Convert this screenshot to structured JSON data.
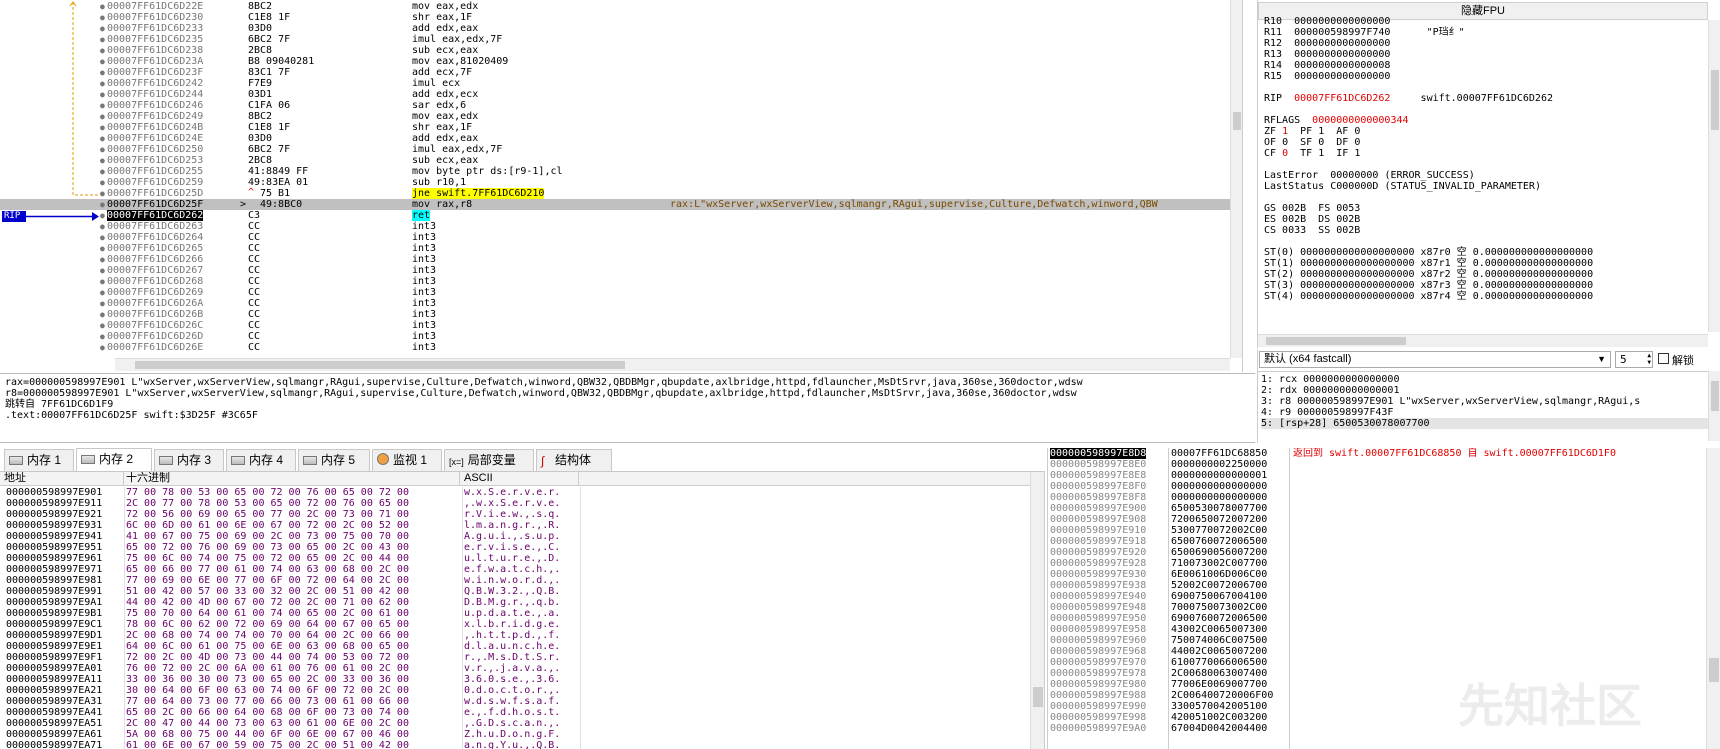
{
  "disasm": {
    "rows": [
      {
        "addr": "00007FF61DC6D22E",
        "bytes": "8BC2",
        "instr": "mov eax,edx",
        "comment": ""
      },
      {
        "addr": "00007FF61DC6D230",
        "bytes": "C1E8 1F",
        "instr": "shr eax,1F",
        "comment": ""
      },
      {
        "addr": "00007FF61DC6D233",
        "bytes": "03D0",
        "instr": "add edx,eax",
        "comment": ""
      },
      {
        "addr": "00007FF61DC6D235",
        "bytes": "6BC2 7F",
        "instr": "imul eax,edx,7F",
        "comment": ""
      },
      {
        "addr": "00007FF61DC6D238",
        "bytes": "2BC8",
        "instr": "sub ecx,eax",
        "comment": ""
      },
      {
        "addr": "00007FF61DC6D23A",
        "bytes": "B8 09040281",
        "instr": "mov eax,81020409",
        "comment": ""
      },
      {
        "addr": "00007FF61DC6D23F",
        "bytes": "83C1 7F",
        "instr": "add ecx,7F",
        "comment": ""
      },
      {
        "addr": "00007FF61DC6D242",
        "bytes": "F7E9",
        "instr": "imul ecx",
        "comment": ""
      },
      {
        "addr": "00007FF61DC6D244",
        "bytes": "03D1",
        "instr": "add edx,ecx",
        "comment": ""
      },
      {
        "addr": "00007FF61DC6D246",
        "bytes": "C1FA 06",
        "instr": "sar edx,6",
        "comment": ""
      },
      {
        "addr": "00007FF61DC6D249",
        "bytes": "8BC2",
        "instr": "mov eax,edx",
        "comment": ""
      },
      {
        "addr": "00007FF61DC6D24B",
        "bytes": "C1E8 1F",
        "instr": "shr eax,1F",
        "comment": ""
      },
      {
        "addr": "00007FF61DC6D24E",
        "bytes": "03D0",
        "instr": "add edx,eax",
        "comment": ""
      },
      {
        "addr": "00007FF61DC6D250",
        "bytes": "6BC2 7F",
        "instr": "imul eax,edx,7F",
        "comment": ""
      },
      {
        "addr": "00007FF61DC6D253",
        "bytes": "2BC8",
        "instr": "sub ecx,eax",
        "comment": ""
      },
      {
        "addr": "00007FF61DC6D255",
        "bytes": "41:8849 FF",
        "instr": "mov byte ptr ds:[r9-1],cl",
        "comment": ""
      },
      {
        "addr": "00007FF61DC6D259",
        "bytes": "49:83EA 01",
        "instr": "sub r10,1",
        "comment": ""
      },
      {
        "addr": "00007FF61DC6D25D",
        "bytes": "75 B1",
        "instr": "jne swift.7FF61DC6D210",
        "comment": ""
      },
      {
        "addr": "00007FF61DC6D25F",
        "bytes": "49:8BC0",
        "instr": "mov rax,r8",
        "comment": "rax:L\"wxServer,wxServerView,sqlmangr,RAgui,supervise,Culture,Defwatch,winword,QBW"
      },
      {
        "addr": "00007FF61DC6D262",
        "bytes": "C3",
        "instr": "ret",
        "comment": ""
      },
      {
        "addr": "00007FF61DC6D263",
        "bytes": "CC",
        "instr": "int3",
        "comment": ""
      },
      {
        "addr": "00007FF61DC6D264",
        "bytes": "CC",
        "instr": "int3",
        "comment": ""
      },
      {
        "addr": "00007FF61DC6D265",
        "bytes": "CC",
        "instr": "int3",
        "comment": ""
      },
      {
        "addr": "00007FF61DC6D266",
        "bytes": "CC",
        "instr": "int3",
        "comment": ""
      },
      {
        "addr": "00007FF61DC6D267",
        "bytes": "CC",
        "instr": "int3",
        "comment": ""
      },
      {
        "addr": "00007FF61DC6D268",
        "bytes": "CC",
        "instr": "int3",
        "comment": ""
      },
      {
        "addr": "00007FF61DC6D269",
        "bytes": "CC",
        "instr": "int3",
        "comment": ""
      },
      {
        "addr": "00007FF61DC6D26A",
        "bytes": "CC",
        "instr": "int3",
        "comment": ""
      },
      {
        "addr": "00007FF61DC6D26B",
        "bytes": "CC",
        "instr": "int3",
        "comment": ""
      },
      {
        "addr": "00007FF61DC6D26C",
        "bytes": "CC",
        "instr": "int3",
        "comment": ""
      },
      {
        "addr": "00007FF61DC6D26D",
        "bytes": "CC",
        "instr": "int3",
        "comment": ""
      },
      {
        "addr": "00007FF61DC6D26E",
        "bytes": "CC",
        "instr": "int3",
        "comment": ""
      }
    ],
    "rip_label": "RIP",
    "current_row": 19,
    "selected_row": 18,
    "jump_row": 17,
    "jump_mark": "^",
    "sel_mark": ">"
  },
  "info": {
    "lines": [
      "rax=000000598997E901 L\"wxServer,wxServerView,sqlmangr,RAgui,supervise,Culture,Defwatch,winword,QBW32,QBDBMgr,qbupdate,axlbridge,httpd,fdlauncher,MsDtSrvr,java,360se,360doctor,wdsw",
      "r8=000000598997E901 L\"wxServer,wxServerView,sqlmangr,RAgui,supervise,Culture,Defwatch,winword,QBW32,QBDBMgr,qbupdate,axlbridge,httpd,fdlauncher,MsDtSrvr,java,360se,360doctor,wdsw",
      "跳转自 7FF61DC6D1F9",
      "",
      ".text:00007FF61DC6D25F swift:$3D25F #3C65F"
    ]
  },
  "registers": {
    "header": "隐藏FPU",
    "lines": [
      {
        "t": "R10  ",
        "v": "0000000000000000",
        "r": "         ",
        "x": ""
      },
      {
        "t": "R11  ",
        "v": "000000598997F740",
        "r": "      ",
        "x": "\"P珰纟\""
      },
      {
        "t": "R12  ",
        "v": "0000000000000000",
        "r": "",
        "x": ""
      },
      {
        "t": "R13  ",
        "v": "0000000000000000",
        "r": "",
        "x": ""
      },
      {
        "t": "R14  ",
        "v": "0000000000000008",
        "r": "",
        "x": ""
      },
      {
        "t": "R15  ",
        "v": "0000000000000000",
        "r": "",
        "x": ""
      },
      {
        "t": "",
        "v": "",
        "r": "",
        "x": ""
      },
      {
        "t": "RIP  ",
        "v": "00007FF61DC6D262",
        "r": "     ",
        "x": "swift.00007FF61DC6D262",
        "red": true
      },
      {
        "t": "",
        "v": "",
        "r": "",
        "x": ""
      },
      {
        "t": "RFLAGS  ",
        "v": "0000000000000344",
        "r": "",
        "x": "",
        "red": true
      },
      {
        "t": "ZF ",
        "v": "1",
        "r": "  PF ",
        "x": "1  AF 0",
        "redv": true
      },
      {
        "t": "OF ",
        "v": "0",
        "r": "  SF ",
        "x": "0  DF 0"
      },
      {
        "t": "CF ",
        "v": "0",
        "r": "  TF ",
        "x": "1  IF 1",
        "redv2": true
      },
      {
        "t": "",
        "v": "",
        "r": "",
        "x": ""
      },
      {
        "t": "LastError  ",
        "v": "00000000",
        "r": " ",
        "x": "(ERROR_SUCCESS)"
      },
      {
        "t": "LastStatus ",
        "v": "C000000D",
        "r": " ",
        "x": "(STATUS_INVALID_PARAMETER)"
      },
      {
        "t": "",
        "v": "",
        "r": "",
        "x": ""
      },
      {
        "t": "GS 002B  FS 0053",
        "v": "",
        "r": "",
        "x": ""
      },
      {
        "t": "ES 002B  DS 002B",
        "v": "",
        "r": "",
        "x": ""
      },
      {
        "t": "CS 0033  SS 002B",
        "v": "",
        "r": "",
        "x": ""
      },
      {
        "t": "",
        "v": "",
        "r": "",
        "x": ""
      },
      {
        "t": "ST(0) ",
        "v": "0000000000000000000",
        "r": " x87r0 ",
        "x": "空 0.000000000000000000"
      },
      {
        "t": "ST(1) ",
        "v": "0000000000000000000",
        "r": " x87r1 ",
        "x": "空 0.000000000000000000"
      },
      {
        "t": "ST(2) ",
        "v": "0000000000000000000",
        "r": " x87r2 ",
        "x": "空 0.000000000000000000"
      },
      {
        "t": "ST(3) ",
        "v": "0000000000000000000",
        "r": " x87r3 ",
        "x": "空 0.000000000000000000"
      },
      {
        "t": "ST(4) ",
        "v": "0000000000000000000",
        "r": " x87r4 ",
        "x": "空 0.000000000000000000"
      }
    ]
  },
  "callconv": {
    "select": "默认 (x64 fastcall)",
    "count": "5",
    "unlock": "解锁",
    "args": [
      "1: rcx 0000000000000000",
      "2: rdx 0000000000000001",
      "3: r8 000000598997E901 L\"wxServer,wxServerView,sqlmangr,RAgui,s",
      "4: r9 000000598997F43F",
      "5: [rsp+28] 6500530078007700"
    ]
  },
  "tabs": [
    {
      "label": "内存 1"
    },
    {
      "label": "内存 2",
      "active": true
    },
    {
      "label": "内存 3"
    },
    {
      "label": "内存 4"
    },
    {
      "label": "内存 5"
    },
    {
      "label": "监视 1"
    },
    {
      "label": "局部变量",
      "pre": "[x=]"
    },
    {
      "label": "结构体"
    }
  ],
  "dump": {
    "headers": [
      "地址",
      "十六进制",
      "ASCII"
    ],
    "rows": [
      {
        "a": "000000598997E901",
        "h": "77 00 78 00 53 00 65 00 72 00 76 00 65 00 72 00",
        "s": "w.x.S.e.r.v.e.r."
      },
      {
        "a": "000000598997E911",
        "h": "2C 00 77 00 78 00 53 00 65 00 72 00 76 00 65 00",
        "s": ",.w.x.S.e.r.v.e."
      },
      {
        "a": "000000598997E921",
        "h": "72 00 56 00 69 00 65 00 77 00 2C 00 73 00 71 00",
        "s": "r.V.i.e.w.,.s.q."
      },
      {
        "a": "000000598997E931",
        "h": "6C 00 6D 00 61 00 6E 00 67 00 72 00 2C 00 52 00",
        "s": "l.m.a.n.g.r.,.R."
      },
      {
        "a": "000000598997E941",
        "h": "41 00 67 00 75 00 69 00 2C 00 73 00 75 00 70 00",
        "s": "A.g.u.i.,.s.u.p."
      },
      {
        "a": "000000598997E951",
        "h": "65 00 72 00 76 00 69 00 73 00 65 00 2C 00 43 00",
        "s": "e.r.v.i.s.e.,.C."
      },
      {
        "a": "000000598997E961",
        "h": "75 00 6C 00 74 00 75 00 72 00 65 00 2C 00 44 00",
        "s": "u.l.t.u.r.e.,.D."
      },
      {
        "a": "000000598997E971",
        "h": "65 00 66 00 77 00 61 00 74 00 63 00 68 00 2C 00",
        "s": "e.f.w.a.t.c.h.,."
      },
      {
        "a": "000000598997E981",
        "h": "77 00 69 00 6E 00 77 00 6F 00 72 00 64 00 2C 00",
        "s": "w.i.n.w.o.r.d.,."
      },
      {
        "a": "000000598997E991",
        "h": "51 00 42 00 57 00 33 00 32 00 2C 00 51 00 42 00",
        "s": "Q.B.W.3.2.,.Q.B."
      },
      {
        "a": "000000598997E9A1",
        "h": "44 00 42 00 4D 00 67 00 72 00 2C 00 71 00 62 00",
        "s": "D.B.M.g.r.,.q.b."
      },
      {
        "a": "000000598997E9B1",
        "h": "75 00 70 00 64 00 61 00 74 00 65 00 2C 00 61 00",
        "s": "u.p.d.a.t.e.,.a."
      },
      {
        "a": "000000598997E9C1",
        "h": "78 00 6C 00 62 00 72 00 69 00 64 00 67 00 65 00",
        "s": "x.l.b.r.i.d.g.e."
      },
      {
        "a": "000000598997E9D1",
        "h": "2C 00 68 00 74 00 74 00 70 00 64 00 2C 00 66 00",
        "s": ",.h.t.t.p.d.,.f."
      },
      {
        "a": "000000598997E9E1",
        "h": "64 00 6C 00 61 00 75 00 6E 00 63 00 68 00 65 00",
        "s": "d.l.a.u.n.c.h.e."
      },
      {
        "a": "000000598997E9F1",
        "h": "72 00 2C 00 4D 00 73 00 44 00 74 00 53 00 72 00",
        "s": "r.,.M.s.D.t.S.r."
      },
      {
        "a": "000000598997EA01",
        "h": "76 00 72 00 2C 00 6A 00 61 00 76 00 61 00 2C 00",
        "s": "v.r.,.j.a.v.a.,."
      },
      {
        "a": "000000598997EA11",
        "h": "33 00 36 00 30 00 73 00 65 00 2C 00 33 00 36 00",
        "s": "3.6.0.s.e.,.3.6."
      },
      {
        "a": "000000598997EA21",
        "h": "30 00 64 00 6F 00 63 00 74 00 6F 00 72 00 2C 00",
        "s": "0.d.o.c.t.o.r.,."
      },
      {
        "a": "000000598997EA31",
        "h": "77 00 64 00 73 00 77 00 66 00 73 00 61 00 66 00",
        "s": "w.d.s.w.f.s.a.f."
      },
      {
        "a": "000000598997EA41",
        "h": "65 00 2C 00 66 00 64 00 68 00 6F 00 73 00 74 00",
        "s": "e.,.f.d.h.o.s.t."
      },
      {
        "a": "000000598997EA51",
        "h": "2C 00 47 00 44 00 73 00 63 00 61 00 6E 00 2C 00",
        "s": ",.G.D.s.c.a.n.,."
      },
      {
        "a": "000000598997EA61",
        "h": "5A 00 68 00 75 00 44 00 6F 00 6E 00 67 00 46 00",
        "s": "Z.h.u.D.o.n.g.F."
      },
      {
        "a": "000000598997EA71",
        "h": "61 00 6E 00 67 00 59 00 75 00 2C 00 51 00 42 00",
        "s": "a.n.g.Y.u.,.Q.B."
      }
    ]
  },
  "stack": {
    "rows": [
      {
        "a": "000000598997E8D8",
        "v": "00007FF61DC68850",
        "c": "返回到 swift.00007FF61DC68850 自 swift.00007FF61DC6D1F0"
      },
      {
        "a": "000000598997E8E0",
        "v": "0000000002250000",
        "c": ""
      },
      {
        "a": "000000598997E8E8",
        "v": "0000000000000001",
        "c": ""
      },
      {
        "a": "000000598997E8F0",
        "v": "0000000000000000",
        "c": ""
      },
      {
        "a": "000000598997E8F8",
        "v": "0000000000000000",
        "c": ""
      },
      {
        "a": "000000598997E900",
        "v": "6500530078007700",
        "c": ""
      },
      {
        "a": "000000598997E908",
        "v": "7200650072007200",
        "c": ""
      },
      {
        "a": "000000598997E910",
        "v": "5300770072002C00",
        "c": ""
      },
      {
        "a": "000000598997E918",
        "v": "6500760072006500",
        "c": ""
      },
      {
        "a": "000000598997E920",
        "v": "6500690056007200",
        "c": ""
      },
      {
        "a": "000000598997E928",
        "v": "710073002C007700",
        "c": ""
      },
      {
        "a": "000000598997E930",
        "v": "6E0061006D006C00",
        "c": ""
      },
      {
        "a": "000000598997E938",
        "v": "52002C0072006700",
        "c": ""
      },
      {
        "a": "000000598997E940",
        "v": "6900750067004100",
        "c": ""
      },
      {
        "a": "000000598997E948",
        "v": "7000750073002C00",
        "c": ""
      },
      {
        "a": "000000598997E950",
        "v": "6900760072006500",
        "c": ""
      },
      {
        "a": "000000598997E958",
        "v": "43002C0065007300",
        "c": ""
      },
      {
        "a": "000000598997E960",
        "v": "750074006C007500",
        "c": ""
      },
      {
        "a": "000000598997E968",
        "v": "44002C0065007200",
        "c": ""
      },
      {
        "a": "000000598997E970",
        "v": "6100770066006500",
        "c": ""
      },
      {
        "a": "000000598997E978",
        "v": "2C00680063007400",
        "c": ""
      },
      {
        "a": "000000598997E980",
        "v": "77006E0069007700",
        "c": ""
      },
      {
        "a": "000000598997E988",
        "v": "2C006400720006F00",
        "c": ""
      },
      {
        "a": "000000598997E990",
        "v": "3300570042005100",
        "c": ""
      },
      {
        "a": "000000598997E998",
        "v": "420051002C003200",
        "c": ""
      },
      {
        "a": "000000598997E9A0",
        "v": "67004D0042004400",
        "c": ""
      }
    ]
  },
  "watermark": "先知社区",
  "colors": {
    "highlight": "#ffff00",
    "selrow": "#c0c0c0",
    "rip": "#0000ff",
    "red": "#e00000"
  }
}
